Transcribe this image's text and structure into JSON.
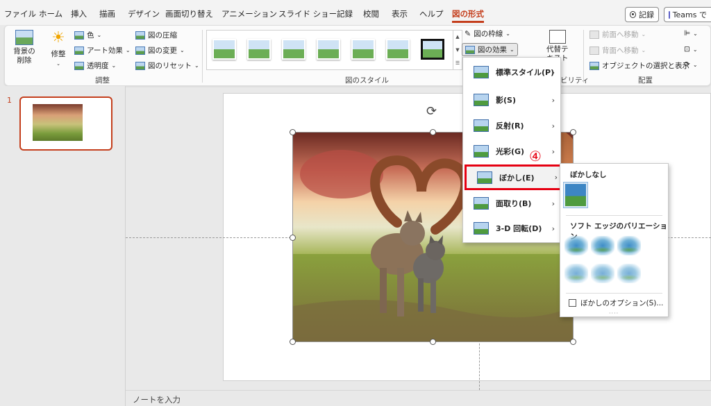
{
  "menu_tabs": [
    "ファイル",
    "ホーム",
    "挿入",
    "描画",
    "デザイン",
    "画面切り替え",
    "アニメーション",
    "スライド ショー",
    "記録",
    "校閲",
    "表示",
    "ヘルプ",
    "図の形式"
  ],
  "top_buttons": {
    "record": "記録",
    "teams": "Teams で"
  },
  "ribbon": {
    "remove_bg": "背景の\n削除",
    "corrections": "修整",
    "color": "色",
    "artistic": "アート効果",
    "transparency": "透明度",
    "compress": "図の圧縮",
    "change": "図の変更",
    "reset": "図のリセット",
    "group_adjust": "調整",
    "group_styles": "図のスタイル",
    "border": "図の枠線",
    "effects": "図の効果",
    "alt_text": "代替テ\nキスト",
    "accessibility_fragment": "ビリティ",
    "bring_forward": "前面へ移動",
    "send_backward": "背面へ移動",
    "selection_pane": "オブジェクトの選択と表示",
    "group_arrange": "配置"
  },
  "slide": {
    "number": "1"
  },
  "notes_placeholder": "ノートを入力",
  "effects_menu": [
    {
      "label": "標準スタイル(P)"
    },
    {
      "label": "影(S)"
    },
    {
      "label": "反射(R)"
    },
    {
      "label": "光彩(G)"
    },
    {
      "label": "ぼかし(E)"
    },
    {
      "label": "面取り(B)"
    },
    {
      "label": "3-D 回転(D)"
    }
  ],
  "soft_edges": {
    "no_blur": "ぼかしなし",
    "variations": "ソフト エッジのバリエーション",
    "options": "ぼかしのオプション(S)...",
    "variation_count": 6
  },
  "annotation": "④",
  "colors": {
    "accent": "#c43e1c",
    "highlight": "#e60012"
  }
}
